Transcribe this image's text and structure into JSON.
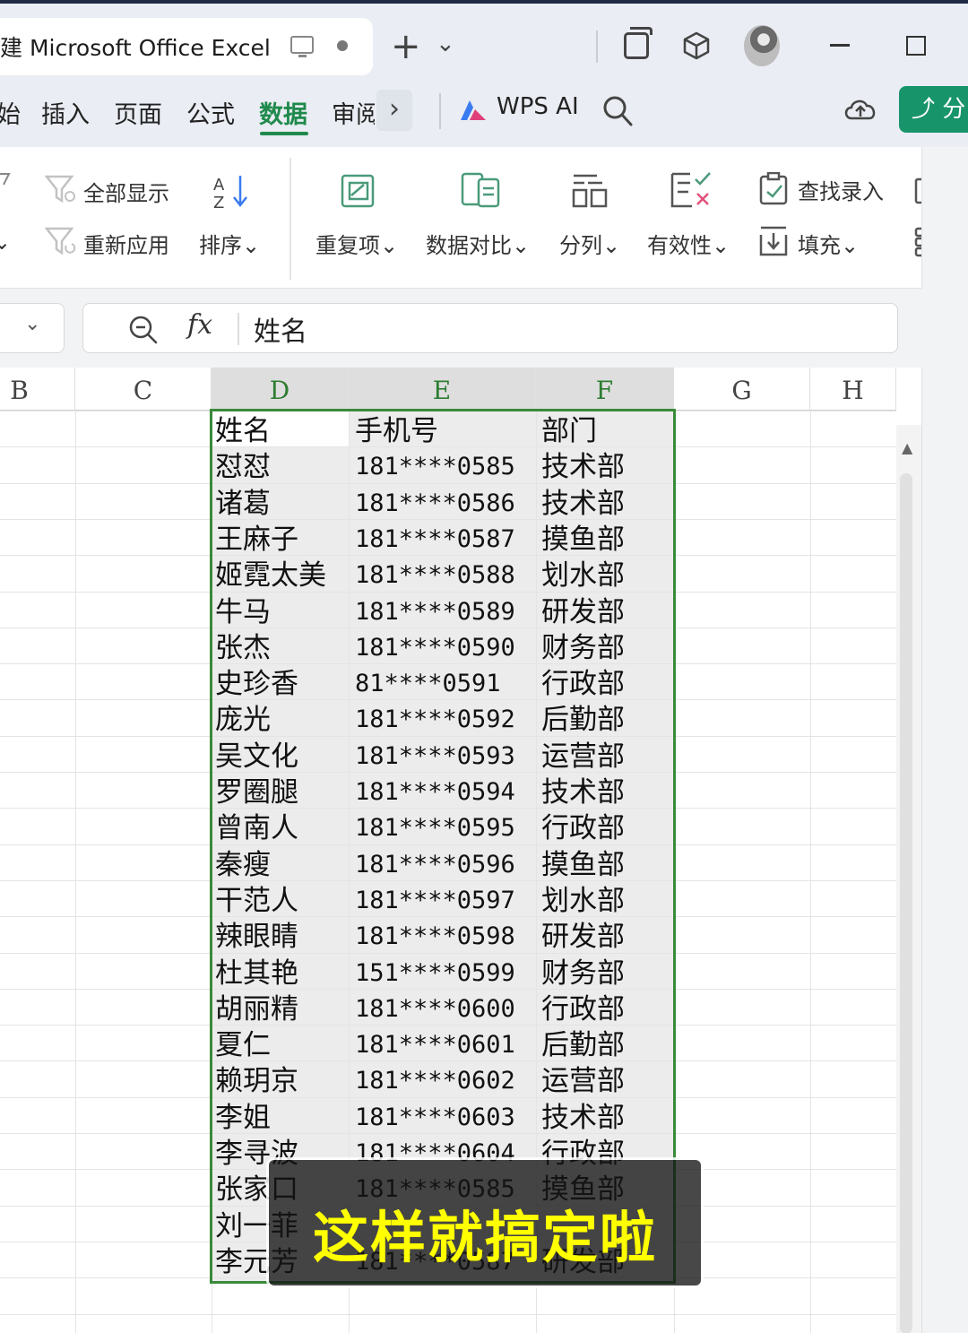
{
  "titlebar": {
    "doc_title": "建 Microsoft Office Excel",
    "new_tab": "+",
    "tab_list": "⌄"
  },
  "menu": {
    "items": [
      "始",
      "插入",
      "页面",
      "公式",
      "数据",
      "审阅"
    ],
    "active": "数据",
    "more": "›",
    "wps_ai": "WPS AI",
    "share": "分"
  },
  "ribbon": {
    "show_all": "全部显示",
    "reapply": "重新应用",
    "sort": "排序",
    "duplicates": "重复项",
    "compare": "数据对比",
    "split": "分列",
    "validity": "有效性",
    "find_entry": "查找录入",
    "fill": "填充",
    "dropdown_glyph": "⌄"
  },
  "formula_bar": {
    "fx": "fx",
    "content": "姓名"
  },
  "sheet": {
    "columns": [
      "B",
      "C",
      "D",
      "E",
      "F",
      "G",
      "H"
    ],
    "selected_columns": [
      "D",
      "E",
      "F"
    ],
    "header_row": {
      "name": "姓名",
      "phone": "手机号",
      "dept": "部门"
    },
    "rows": [
      {
        "name": "怼怼",
        "phone": "181****0585",
        "dept": "技术部"
      },
      {
        "name": "诸葛",
        "phone": "181****0586",
        "dept": "技术部"
      },
      {
        "name": "王麻子",
        "phone": "181****0587",
        "dept": "摸鱼部"
      },
      {
        "name": "姬霓太美",
        "phone": "181****0588",
        "dept": "划水部"
      },
      {
        "name": "牛马",
        "phone": "181****0589",
        "dept": "研发部"
      },
      {
        "name": "张杰",
        "phone": "181****0590",
        "dept": "财务部"
      },
      {
        "name": "史珍香",
        "phone": "81****0591",
        "dept": "行政部"
      },
      {
        "name": "庞光",
        "phone": "181****0592",
        "dept": "后勤部"
      },
      {
        "name": "吴文化",
        "phone": "181****0593",
        "dept": "运营部"
      },
      {
        "name": "罗圈腿",
        "phone": "181****0594",
        "dept": "技术部"
      },
      {
        "name": "曾南人",
        "phone": "181****0595",
        "dept": "行政部"
      },
      {
        "name": "秦瘦",
        "phone": "181****0596",
        "dept": "摸鱼部"
      },
      {
        "name": "干范人",
        "phone": "181****0597",
        "dept": "划水部"
      },
      {
        "name": "辣眼睛",
        "phone": "181****0598",
        "dept": "研发部"
      },
      {
        "name": "杜其艳",
        "phone": "151****0599",
        "dept": "财务部"
      },
      {
        "name": "胡丽精",
        "phone": "181****0600",
        "dept": "行政部"
      },
      {
        "name": "夏仁",
        "phone": "181****0601",
        "dept": "后勤部"
      },
      {
        "name": "赖玥京",
        "phone": "181****0602",
        "dept": "运营部"
      },
      {
        "name": "李姐",
        "phone": "181****0603",
        "dept": "技术部"
      },
      {
        "name": "李寻波",
        "phone": "181****0604",
        "dept": "行政部"
      },
      {
        "name": "张家口",
        "phone": "181****0585",
        "dept": "摸鱼部"
      },
      {
        "name": "刘一菲",
        "phone": "",
        "dept": ""
      },
      {
        "name": "李元芳",
        "phone": "181****0587",
        "dept": "研发部"
      }
    ]
  },
  "caption": "这样就搞定啦",
  "colors": {
    "accent_green": "#1f8a4c",
    "selection_border": "#3a8a3a",
    "share_button": "#18946a",
    "caption_text": "#ffff00"
  }
}
